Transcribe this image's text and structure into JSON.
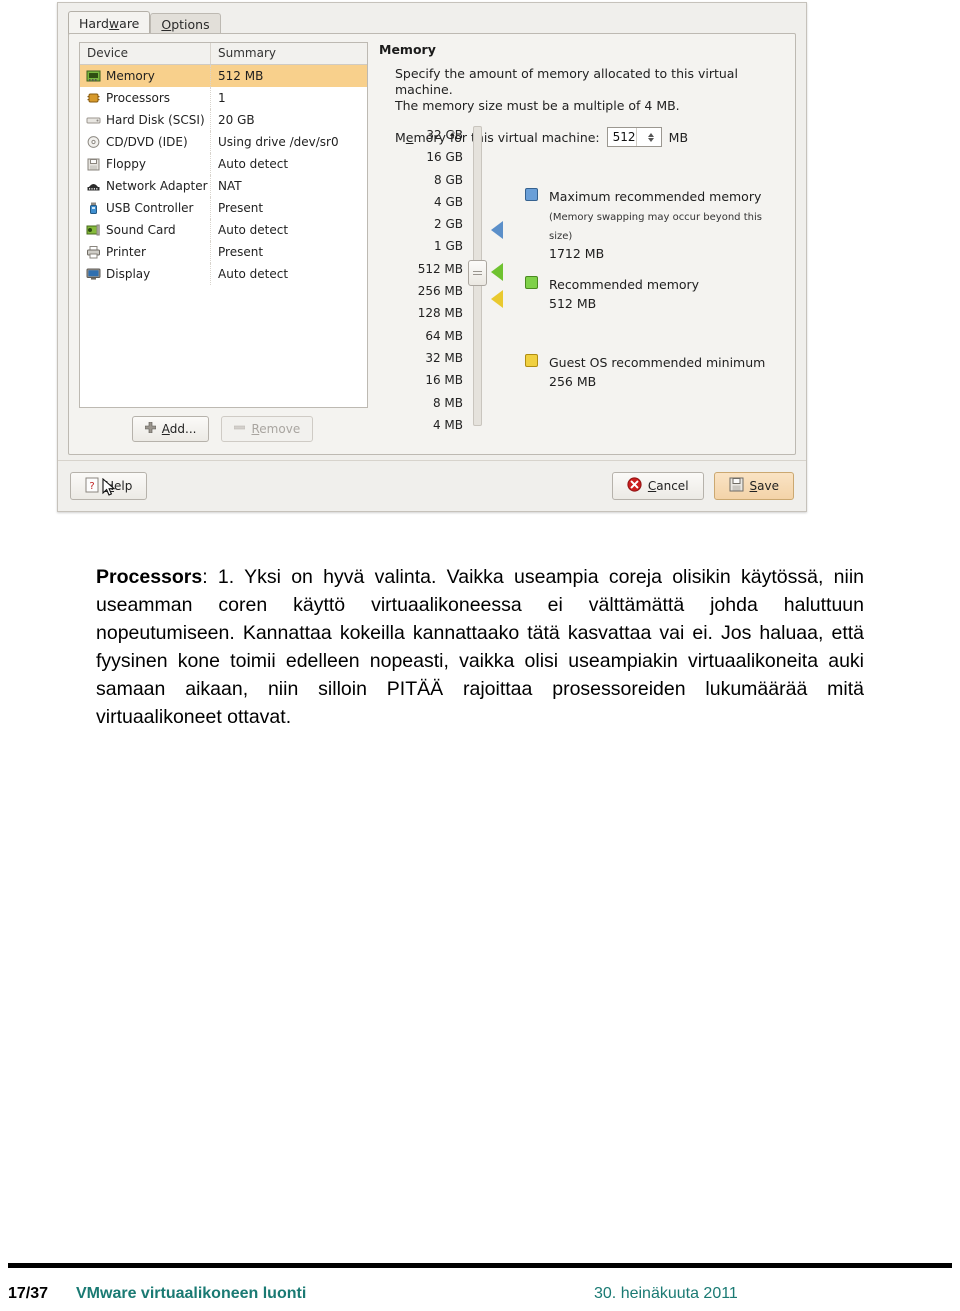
{
  "dialog": {
    "tabs": [
      {
        "label": "Hardware",
        "accel": "w",
        "active": true
      },
      {
        "label": "Options",
        "accel": "O",
        "active": false
      }
    ],
    "device_table": {
      "headers": [
        "Device",
        "Summary"
      ],
      "rows": [
        {
          "icon": "memory-icon",
          "device": "Memory",
          "summary": "512 MB",
          "selected": true
        },
        {
          "icon": "processor-icon",
          "device": "Processors",
          "summary": "1",
          "selected": false
        },
        {
          "icon": "harddisk-icon",
          "device": "Hard Disk (SCSI)",
          "summary": "20 GB",
          "selected": false
        },
        {
          "icon": "cddvd-icon",
          "device": "CD/DVD (IDE)",
          "summary": "Using drive /dev/sr0",
          "selected": false
        },
        {
          "icon": "floppy-icon",
          "device": "Floppy",
          "summary": "Auto detect",
          "selected": false
        },
        {
          "icon": "network-adapter-icon",
          "device": "Network Adapter",
          "summary": "NAT",
          "selected": false
        },
        {
          "icon": "usb-icon",
          "device": "USB Controller",
          "summary": "Present",
          "selected": false
        },
        {
          "icon": "soundcard-icon",
          "device": "Sound Card",
          "summary": "Auto detect",
          "selected": false
        },
        {
          "icon": "printer-icon",
          "device": "Printer",
          "summary": "Present",
          "selected": false
        },
        {
          "icon": "display-icon",
          "device": "Display",
          "summary": "Auto detect",
          "selected": false
        }
      ]
    },
    "list_buttons": {
      "add_label": "Add...",
      "add_accel": "A",
      "remove_label": "Remove",
      "remove_accel": "R",
      "remove_disabled": true
    },
    "memory_pane": {
      "heading": "Memory",
      "description_line1": "Specify the amount of memory allocated to this virtual machine.",
      "description_line2": "The memory size must be a multiple of 4 MB.",
      "field_label_pre": "M",
      "field_label_accel": "e",
      "field_label_post": "mory for this virtual machine:",
      "field_value": "512",
      "field_unit": "MB",
      "scale_ticks": [
        "32 GB",
        "16 GB",
        "8 GB",
        "4 GB",
        "2 GB",
        "1 GB",
        "512 MB",
        "256 MB",
        "128 MB",
        "64 MB",
        "32 MB",
        "16 MB",
        "8 MB",
        "4 MB"
      ],
      "slider_position_label": "512 MB",
      "markers": [
        {
          "name": "maximum-recommended-marker",
          "color": "#5b8fc9",
          "at": "2 GB"
        },
        {
          "name": "recommended-marker",
          "color": "#6fc230",
          "at": "512 MB"
        },
        {
          "name": "guest-minimum-marker",
          "color": "#e9c92f",
          "at": "256 MB"
        }
      ],
      "legend": [
        {
          "swatch_color": "#6a9fd8",
          "title": "Maximum recommended memory",
          "note": "(Memory swapping may occur beyond this size)",
          "value": "1712 MB"
        },
        {
          "swatch_color": "#7fd149",
          "title": "Recommended memory",
          "note": "",
          "value": "512 MB"
        },
        {
          "swatch_color": "#f0d040",
          "title": "Guest OS recommended minimum",
          "note": "",
          "value": "256 MB"
        }
      ]
    },
    "action_bar": {
      "help_label": "Help",
      "help_accel": "H",
      "cancel_label": "Cancel",
      "cancel_accel": "C",
      "save_label": "Save",
      "save_accel": "S"
    }
  },
  "body": {
    "lead": "Processors",
    "text": ": 1. Yksi on hyvä valinta. Vaikka useampia coreja olisikin käytössä, niin useamman coren käyttö virtuaalikoneessa ei välttämättä johda haluttuun nopeutumiseen. Kannattaa kokeilla kannattaako tätä kasvattaa vai ei. Jos haluaa, että fyysinen kone toimii edelleen nopeasti, vaikka olisi useampiakin virtuaalikoneita auki samaan aikaan, niin silloin PITÄÄ rajoittaa prosessoreiden lukumäärää mitä virtuaalikoneet ottavat."
  },
  "footer": {
    "page": "17/37",
    "title": "VMware virtuaalikoneen luonti",
    "date": "30. heinäkuuta 2011",
    "accent_color": "#1a7a73"
  }
}
